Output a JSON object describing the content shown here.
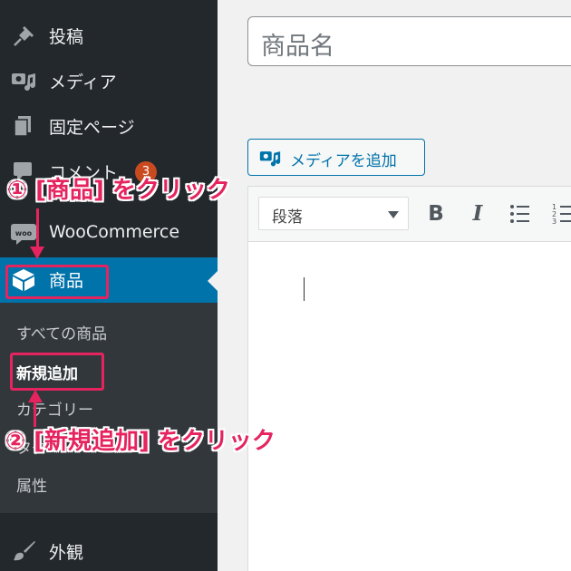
{
  "sidebar": {
    "items": [
      {
        "label": "投稿",
        "icon": "pushpin-icon"
      },
      {
        "label": "メディア",
        "icon": "media-icon"
      },
      {
        "label": "固定ページ",
        "icon": "pages-icon"
      },
      {
        "label": "コメント",
        "icon": "comments-icon",
        "badge": "3"
      },
      {
        "label": "WooCommerce",
        "icon": "woocommerce-icon"
      },
      {
        "label": "商品",
        "icon": "product-box-icon"
      },
      {
        "label": "外観",
        "icon": "paintbrush-icon"
      }
    ],
    "submenu": [
      "すべての商品",
      "新規追加",
      "カテゴリー",
      "タグ",
      "属性"
    ]
  },
  "editor": {
    "title_placeholder": "商品名",
    "add_media_label": "メディアを追加",
    "format_select": "段落",
    "bold_label": "B",
    "italic_label": "I"
  },
  "annotations": {
    "step1": "① [商品] をクリック",
    "step2": "② [新規追加] をクリック"
  },
  "colors": {
    "sidebar_bg": "#23282d",
    "submenu_bg": "#32373c",
    "active_bg": "#0073aa",
    "accent": "#e5245f",
    "badge": "#ca4a1f"
  }
}
